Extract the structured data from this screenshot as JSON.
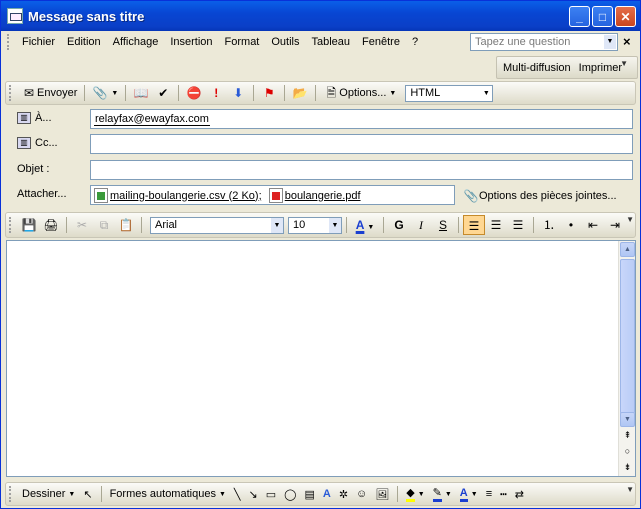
{
  "window": {
    "title": "Message sans titre"
  },
  "menu": {
    "items": [
      "Fichier",
      "Edition",
      "Affichage",
      "Insertion",
      "Format",
      "Outils",
      "Tableau",
      "Fenêtre",
      "?"
    ],
    "help_placeholder": "Tapez une question"
  },
  "toolbar2": {
    "multi_diffusion": "Multi-diffusion",
    "print": "Imprimer"
  },
  "toolbar": {
    "send": "Envoyer",
    "options": "Options...",
    "format_value": "HTML"
  },
  "fields": {
    "to_label": "À...",
    "to_value": "relayfax@ewayfax.com",
    "cc_label": "Cc...",
    "cc_value": "",
    "subject_label": "Objet :",
    "subject_value": "",
    "attach_label": "Attacher...",
    "attachments": [
      "mailing-boulangerie.csv (2 Ko);",
      "boulangerie.pdf"
    ],
    "attach_options": "Options des pièces jointes..."
  },
  "format_bar": {
    "font": "Arial",
    "size": "10",
    "bold": "G",
    "italic": "I",
    "underline": "S"
  },
  "drawing_bar": {
    "draw": "Dessiner",
    "autoshapes": "Formes automatiques"
  }
}
